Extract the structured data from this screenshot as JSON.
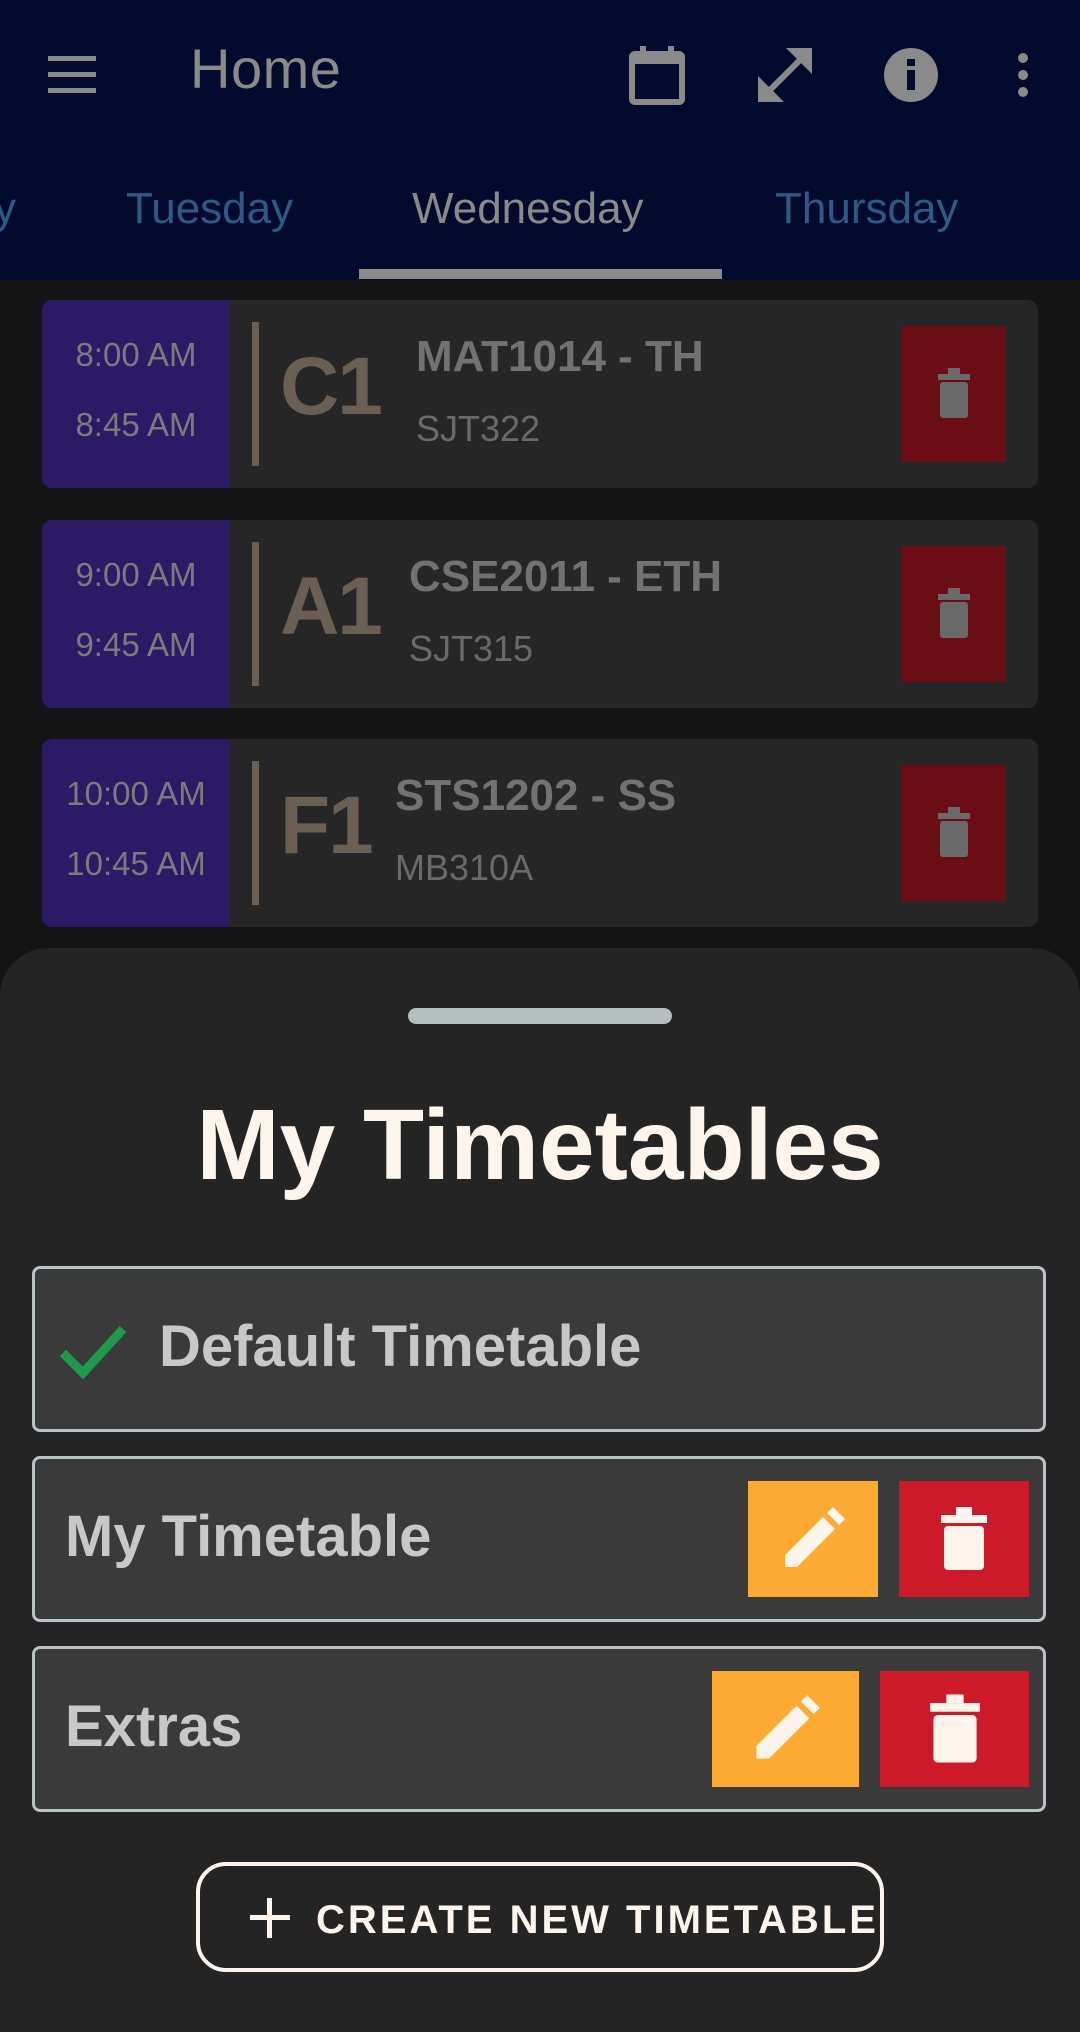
{
  "appbar": {
    "title": "Home",
    "icons": [
      "menu-icon",
      "calendar-icon",
      "fullscreen-icon",
      "info-icon",
      "more-vert-icon"
    ]
  },
  "tabs": {
    "items": [
      "Monday",
      "Tuesday",
      "Wednesday",
      "Thursday"
    ],
    "partial_left": "y",
    "selected": "Wednesday"
  },
  "classes": [
    {
      "start": "8:00 AM",
      "end": "8:45 AM",
      "slot": "C1",
      "course": "MAT1014 - TH",
      "room": "SJT322"
    },
    {
      "start": "9:00 AM",
      "end": "9:45 AM",
      "slot": "A1",
      "course": "CSE2011 - ETH",
      "room": "SJT315"
    },
    {
      "start": "10:00 AM",
      "end": "10:45 AM",
      "slot": "F1",
      "course": "STS1202 - SS",
      "room": "MB310A"
    }
  ],
  "sheet": {
    "title": "My Timetables",
    "timetables": [
      {
        "name": "Default Timetable",
        "active": true
      },
      {
        "name": "My Timetable",
        "active": false
      },
      {
        "name": "Extras",
        "active": false
      }
    ],
    "create_label": "CREATE NEW TIMETABLE"
  },
  "colors": {
    "appbar": "#020b2e",
    "time_block": "#2c1a66",
    "edit": "#fcaa31",
    "delete": "#cc1a2b",
    "check": "#1e9a4a"
  }
}
